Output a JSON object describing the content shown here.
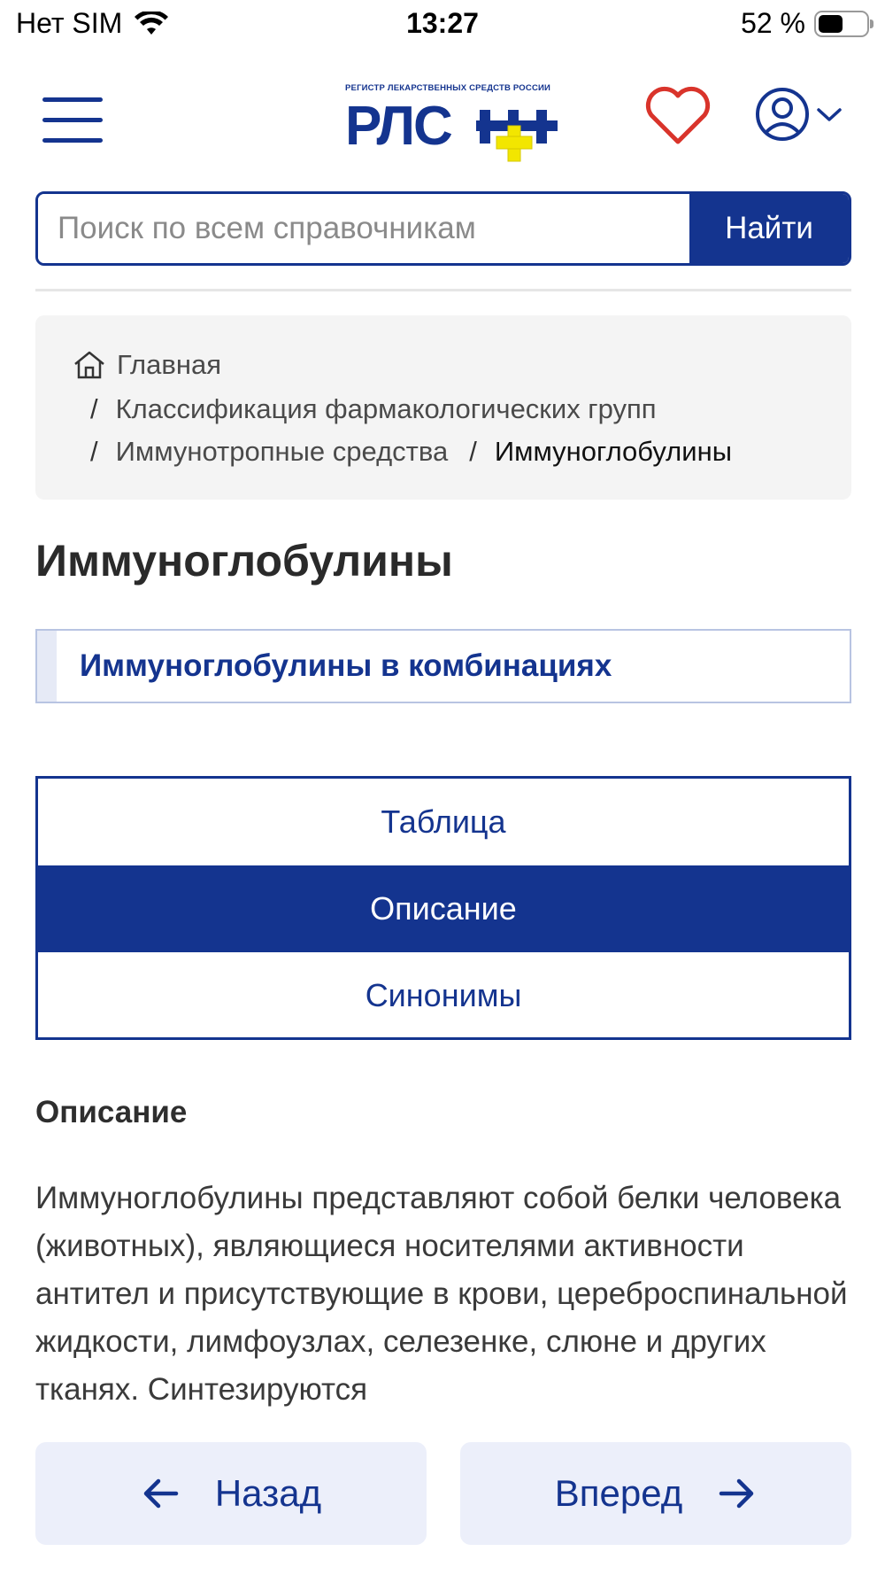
{
  "status_bar": {
    "carrier": "Нет SIM",
    "time": "13:27",
    "battery": "52 %",
    "battery_level": 0.52
  },
  "header": {
    "logo_tagline": "РЕГИСТР ЛЕКАРСТВЕННЫХ СРЕДСТВ РОССИИ",
    "logo_text": "РЛС",
    "logo_mark": "®",
    "icons": {
      "menu": "menu-icon",
      "favorites": "heart-icon",
      "account": "user-icon",
      "account_dropdown": "chevron-down-icon"
    }
  },
  "search": {
    "placeholder": "Поиск по всем справочникам",
    "value": "",
    "button_label": "Найти"
  },
  "breadcrumb": {
    "home": "Главная",
    "separator": "/",
    "items": [
      "Классификация фармакологических групп",
      "Иммунотропные средства",
      "Иммуноглобулины"
    ]
  },
  "page": {
    "title": "Иммуноглобулины",
    "subgroup_link": "Иммуноглобулины в комбинациях"
  },
  "tabs": [
    {
      "label": "Таблица",
      "active": false
    },
    {
      "label": "Описание",
      "active": true
    },
    {
      "label": "Синонимы",
      "active": false
    }
  ],
  "description": {
    "heading": "Описание",
    "text": "Иммуноглобулины представляют собой белки человека (животных), являющиеся носителями активности антител и присутствующие в крови, цереброспинальной жидкости, лимфоузлах, селезенке, слюне и других тканях. Синтезируются"
  },
  "navigation": {
    "back_label": "Назад",
    "next_label": "Вперед"
  },
  "colors": {
    "brand": "#14348f",
    "accent_yellow": "#f2e600",
    "favorite": "#d9342b"
  }
}
